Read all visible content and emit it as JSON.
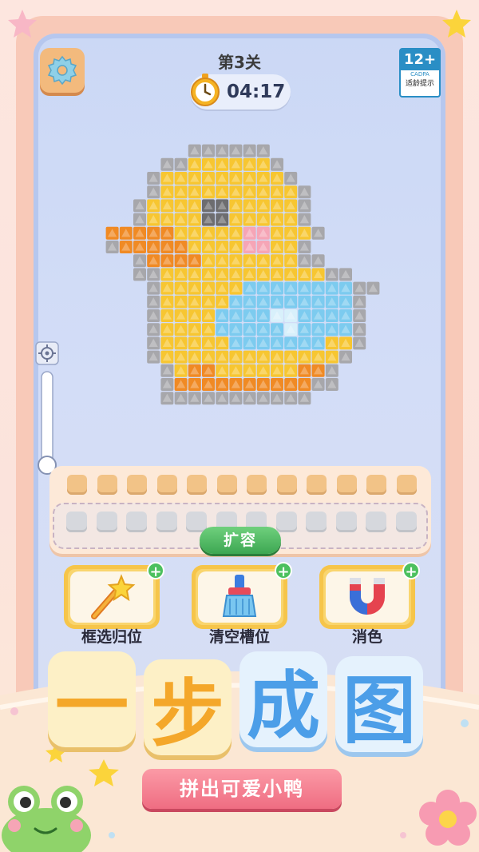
{
  "level": {
    "title": "第3关"
  },
  "timer": {
    "value": "04:17"
  },
  "age_rating": {
    "label": "12+",
    "org": "CADPA",
    "note": "适龄提示"
  },
  "tray": {
    "expand_label": "扩容"
  },
  "tools": [
    {
      "label": "框选归位"
    },
    {
      "label": "清空槽位"
    },
    {
      "label": "消色"
    }
  ],
  "banner": {
    "title_chars": [
      "一",
      "步",
      "成",
      "图"
    ],
    "subtitle": "拼出可爱小鸭"
  },
  "colors": {
    "duck_yellow": "#f7c631",
    "beak_orange": "#f08a24",
    "wing_blue": "#7ccbef",
    "outline_gray": "#a7a7ab",
    "cheek_pink": "#f6a5b6",
    "eye_dark": "#6d6d70"
  }
}
